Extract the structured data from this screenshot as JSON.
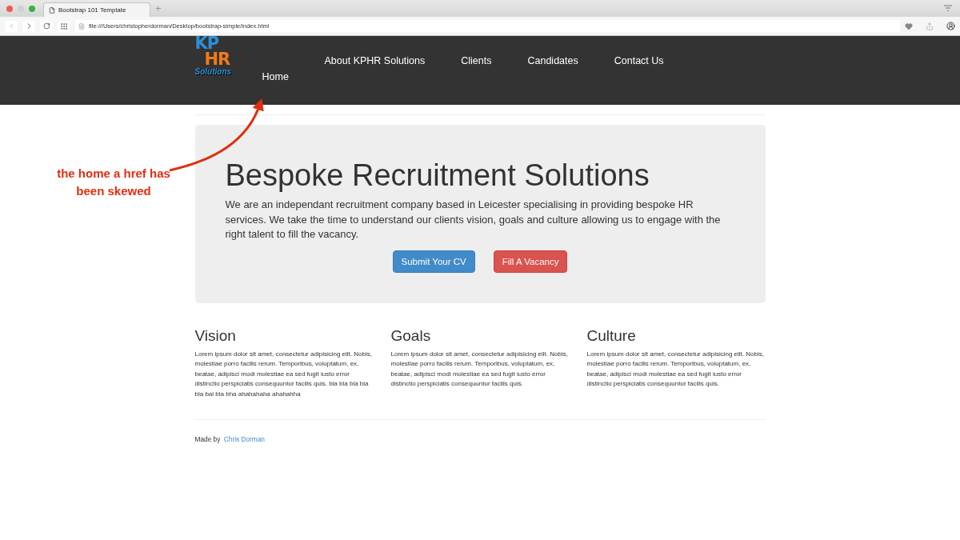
{
  "browser": {
    "tab_title": "Bootstrap 101 Template",
    "new_tab": "+",
    "url": "file:///Users/christopherdorman/Desktop/bootstrap-simple/index.html"
  },
  "logo": {
    "line_1": "KP",
    "line_2": "HR",
    "line_3": "Solutions"
  },
  "nav_row_1": [
    "About KPHR Solutions",
    "Clients",
    "Candidates",
    "Contact Us"
  ],
  "nav_row_2": [
    "Home"
  ],
  "annotation": "the home a href has been skewed",
  "jumbotron": {
    "title": "Bespoke Recruitment Solutions",
    "text": "We are an independant recruitment company based in Leicester specialising in providing bespoke HR services. We take the time to understand our clients vision, goals and culture allowing us to engage with the right talent to fill the vacancy.",
    "buttons": [
      {
        "label": "Submit Your CV",
        "kind": "primary"
      },
      {
        "label": "Fill A Vacancy",
        "kind": "danger"
      }
    ]
  },
  "columns": [
    {
      "title": "Vision",
      "text": "Lorem ipsum dolor sit amet, consectetur adipisicing elit. Nobis, molestiae porro facilis rerum. Temporibus, voluptatum, ex, beatae, adipisci modi molestiae ea sed fugit iusto error distinctio perspiciatis consequuntur facilis quis. bla bla bla bla bla bal bla bha ahahahaha ahahahha"
    },
    {
      "title": "Goals",
      "text": "Lorem ipsum dolor sit amet, consectetur adipisicing elit. Nobis, molestiae porro facilis rerum. Temporibus, voluptatum, ex, beatae, adipisci modi molestiae ea sed fugit iusto error distinctio perspiciatis consequuntur facilis quis."
    },
    {
      "title": "Culture",
      "text": "Lorem ipsum dolor sit amet, consectetur adipisicing elit. Nobis, molestiae porro facilis rerum. Temporibus, voluptatum, ex, beatae, adipisci modi molestiae ea sed fugit iusto error distinctio perspiciatis consequuntur facilis quis."
    }
  ],
  "footer": {
    "text": "Made by",
    "link": "Chris Dorman"
  }
}
